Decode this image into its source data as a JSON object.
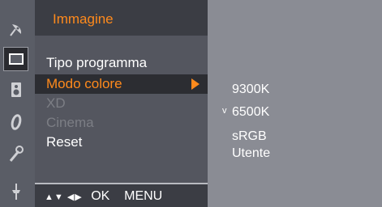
{
  "rail": {
    "icons": [
      "satellite-dish-icon",
      "screen-icon",
      "speaker-icon",
      "clock-icon",
      "wrench-icon",
      "plug-icon"
    ],
    "active_index": 1
  },
  "menu": {
    "title": "Immagine",
    "items": [
      {
        "label": "Tipo programma",
        "state": "normal"
      },
      {
        "label": "Modo colore",
        "state": "highlight"
      },
      {
        "label": "XD",
        "state": "disabled"
      },
      {
        "label": "Cinema",
        "state": "disabled"
      },
      {
        "label": "Reset",
        "state": "normal"
      }
    ],
    "footer": {
      "nav_glyphs": "▲▼ ◀▶",
      "ok": "OK",
      "menu": "MENU"
    }
  },
  "submenu": {
    "items": [
      {
        "label": "9300K",
        "checked": false
      },
      {
        "label": "6500K",
        "checked": true
      },
      {
        "label": "sRGB",
        "checked": false
      },
      {
        "label": "Utente",
        "checked": false
      }
    ],
    "check_mark": "v"
  },
  "colors": {
    "accent": "#ff8a1c",
    "panel": "#54565f",
    "submenu": "#8a8c94"
  }
}
